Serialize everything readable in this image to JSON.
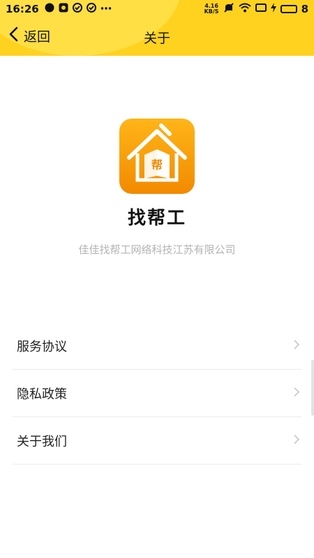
{
  "status_bar": {
    "time": "16:26",
    "net_speed_value": "4.16",
    "net_speed_unit": "KB/S",
    "battery": "8"
  },
  "header": {
    "back_label": "返回",
    "title": "关于"
  },
  "app": {
    "name": "找帮工",
    "company": "佳佳找帮工网络科技江苏有限公司",
    "icon_text": "帮"
  },
  "menu": {
    "items": [
      {
        "label": "服务协议"
      },
      {
        "label": "隐私政策"
      },
      {
        "label": "关于我们"
      }
    ]
  },
  "colors": {
    "header_bg": "#FFD21F",
    "icon_gradient_top": "#FFB518",
    "icon_gradient_bottom": "#F28A00"
  }
}
